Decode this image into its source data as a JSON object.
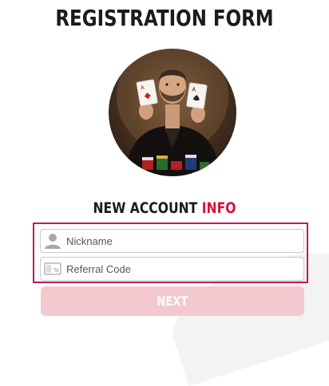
{
  "header": {
    "title": "REGISTRATION FORM"
  },
  "section": {
    "title_main": "NEW ACCOUNT",
    "title_accent": "INFO"
  },
  "colors": {
    "accent": "#d3123b",
    "form_border": "#c2185b",
    "button_bg": "#f3c9cf"
  },
  "form": {
    "fields": [
      {
        "icon": "user-icon",
        "placeholder": "Nickname",
        "value": ""
      },
      {
        "icon": "referral-ticket-icon",
        "placeholder": "Referral Code",
        "value": ""
      }
    ],
    "next_label": "NEXT"
  },
  "hero": {
    "icon": "poker-player-avatar"
  }
}
